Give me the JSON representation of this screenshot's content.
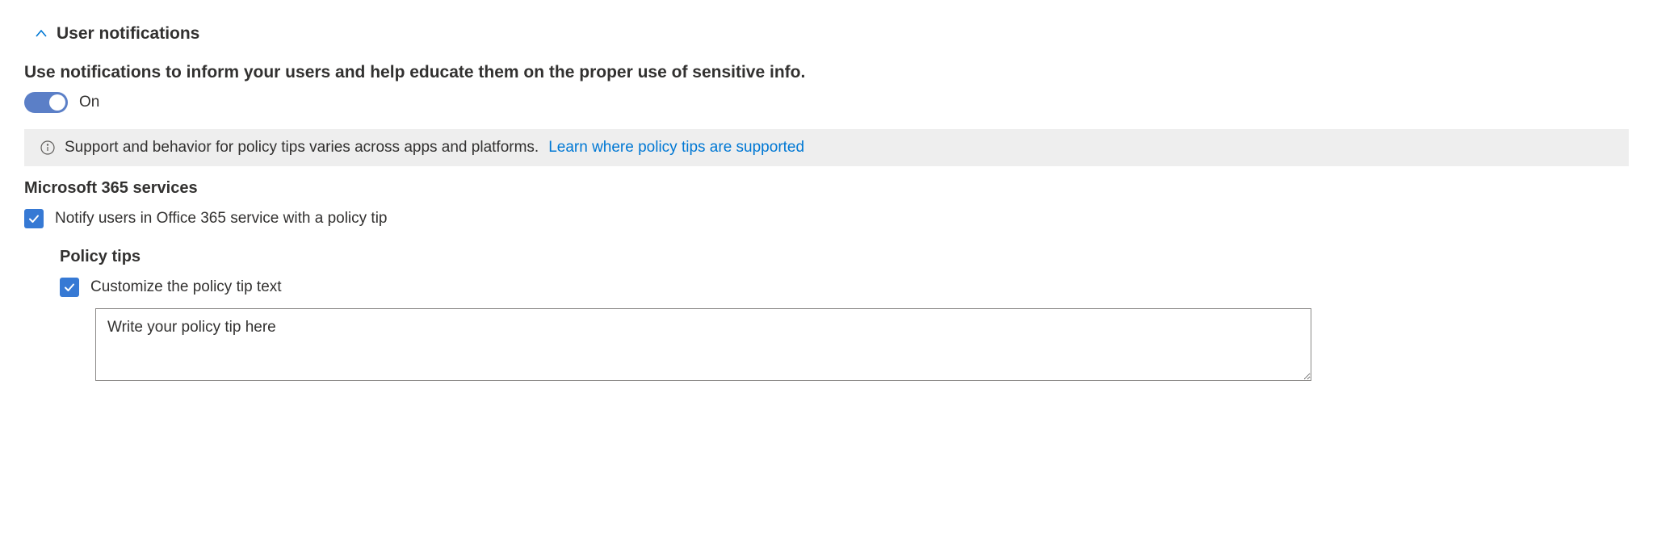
{
  "section": {
    "title": "User notifications",
    "description": "Use notifications to inform your users and help educate them on the proper use of sensitive info.",
    "toggle_state": "On"
  },
  "info": {
    "text": "Support and behavior for policy tips varies across apps and platforms.",
    "link": "Learn where policy tips are supported"
  },
  "m365": {
    "title": "Microsoft 365 services",
    "notify_label": "Notify users in Office 365 service with a policy tip"
  },
  "policy_tips": {
    "title": "Policy tips",
    "customize_label": "Customize the policy tip text",
    "textarea_value": "Write your policy tip here"
  }
}
